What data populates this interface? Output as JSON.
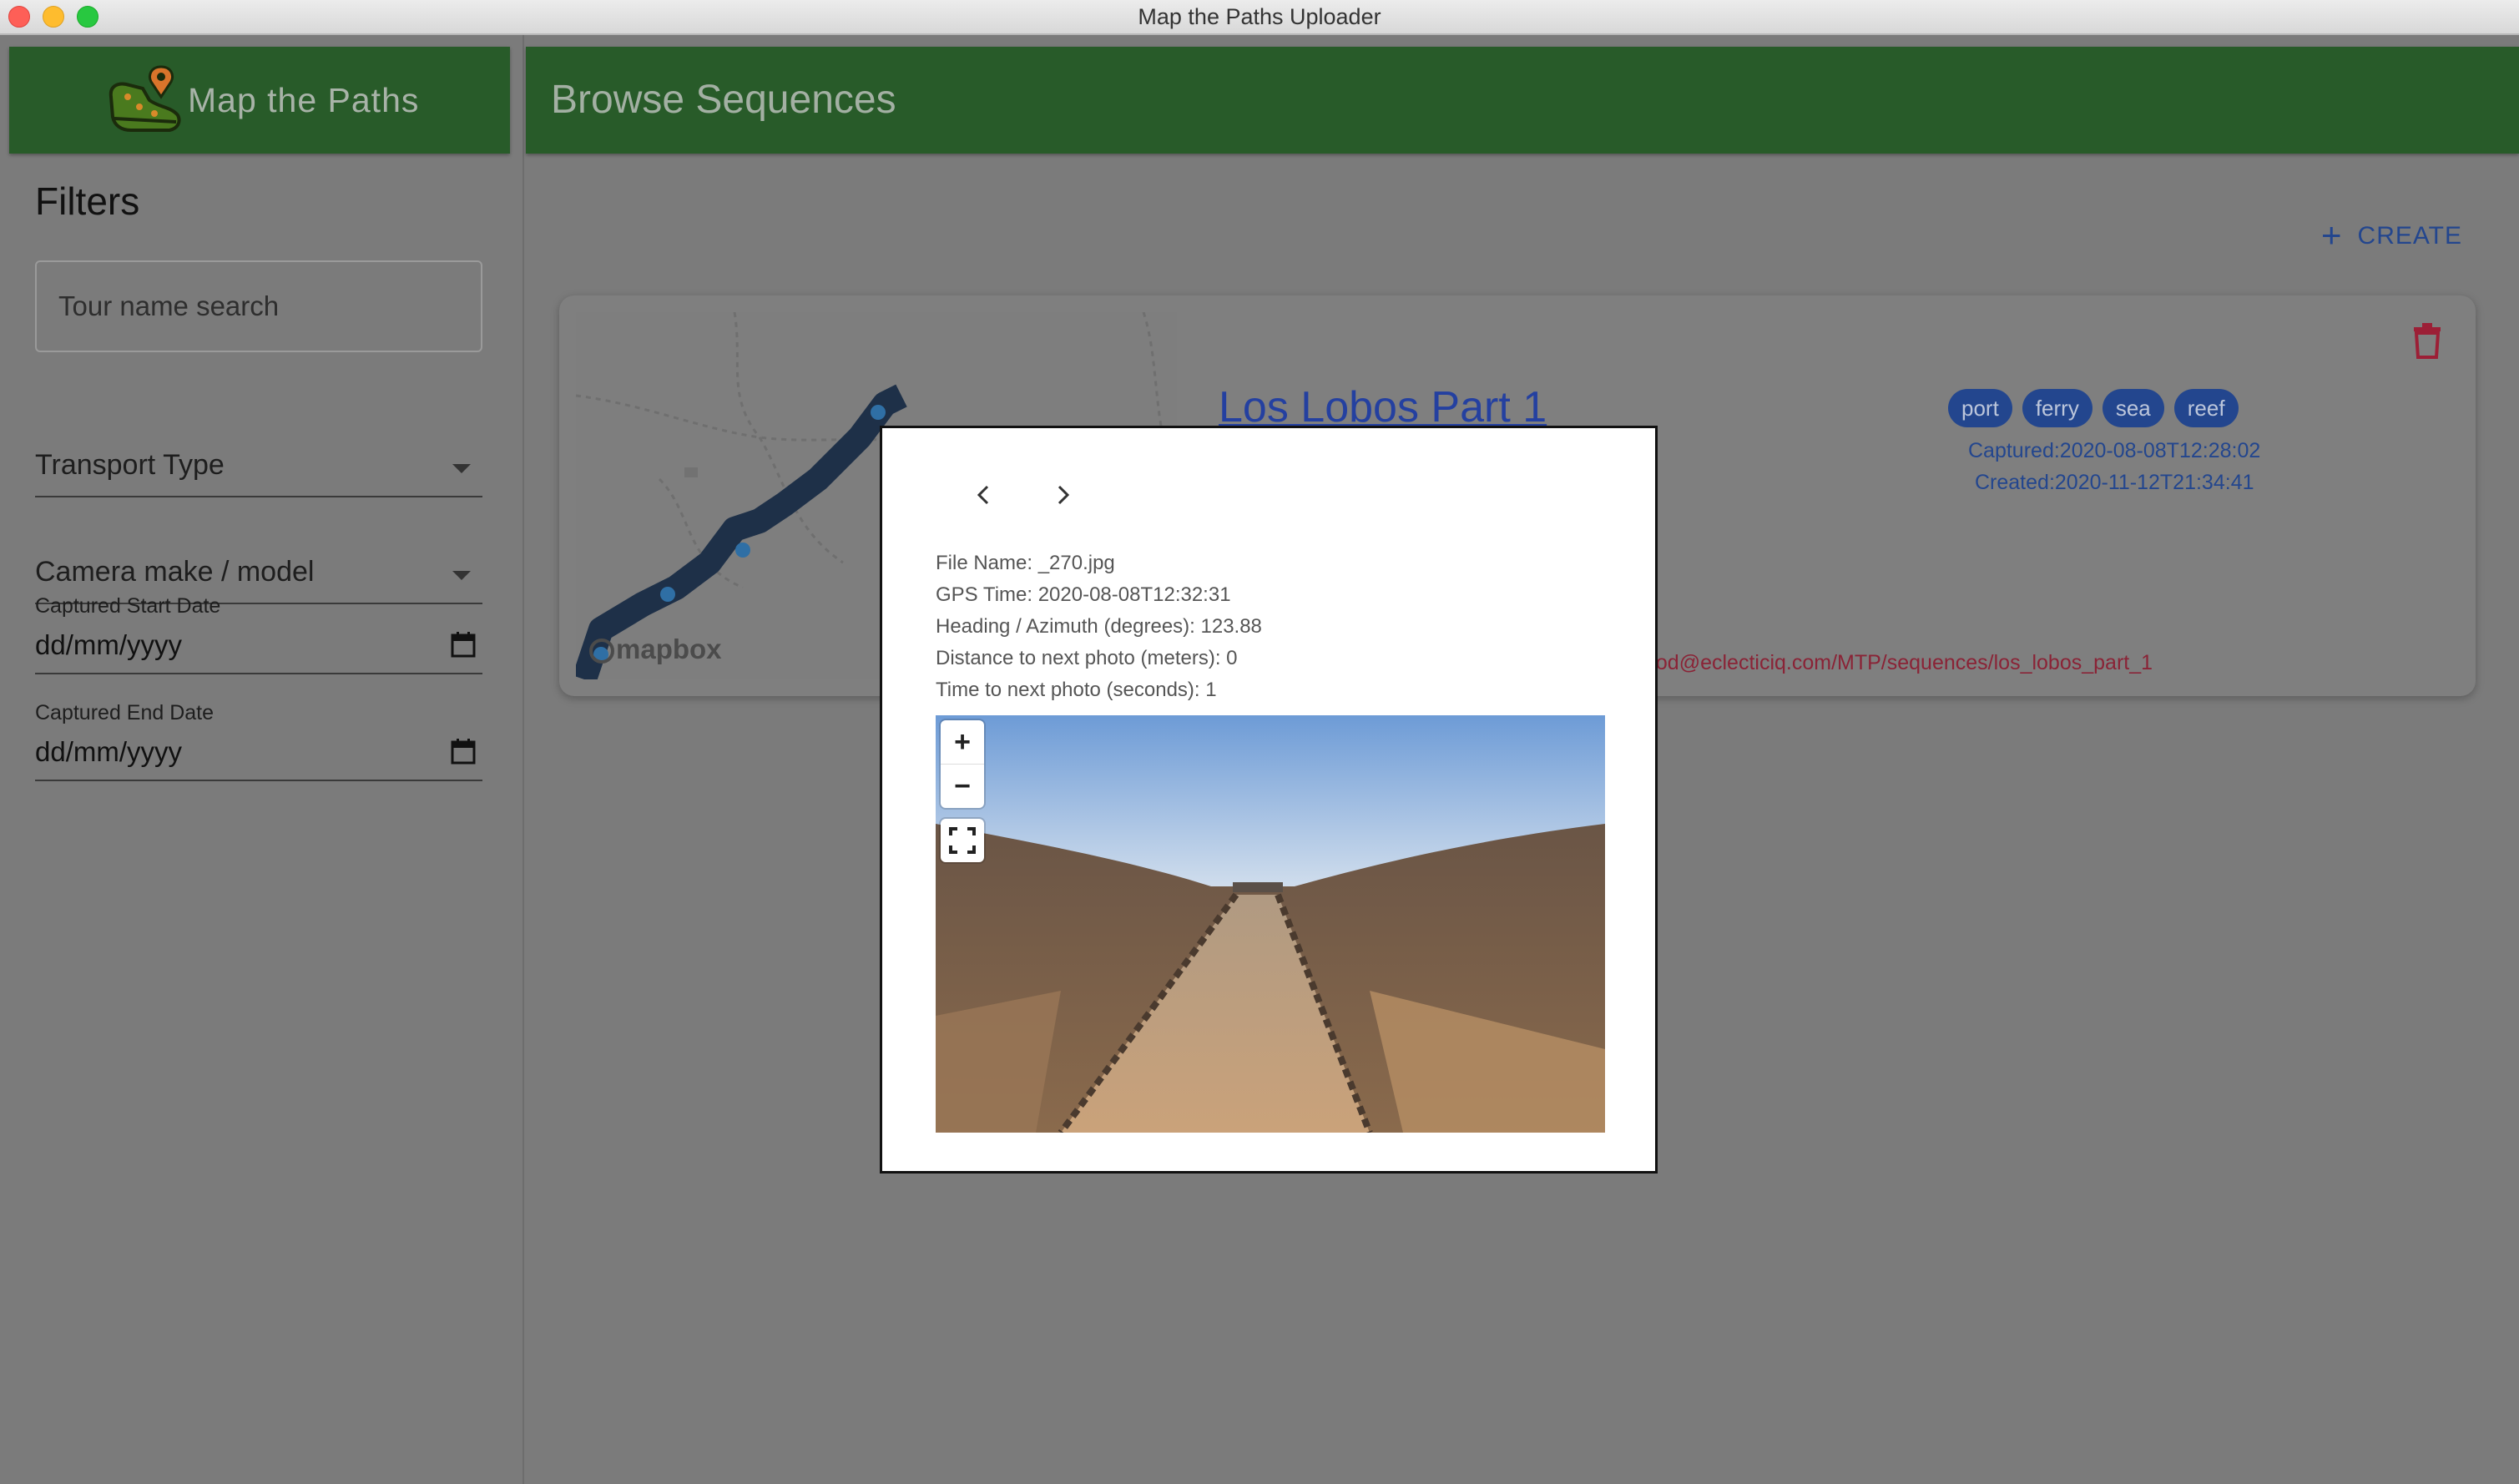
{
  "window": {
    "title": "Map the Paths Uploader"
  },
  "sidebar": {
    "brand": "Map the Paths",
    "filters_title": "Filters",
    "search_placeholder": "Tour name search",
    "transport_label": "Transport Type",
    "camera_label": "Camera make / model",
    "start_date_label": "Captured Start Date",
    "start_date_value": "dd/mm/yyyy",
    "end_date_label": "Captured End Date",
    "end_date_value": "dd/mm/yyyy"
  },
  "main": {
    "title": "Browse Sequences",
    "create_label": "CREATE",
    "card": {
      "title": "Los Lobos Part 1",
      "tags": [
        "port",
        "ferry",
        "sea",
        "reef"
      ],
      "captured": "Captured:2020-08-08T12:28:02",
      "created": "Created:2020-11-12T21:34:41",
      "link": "ood@eclecticiq.com/MTP/sequences/los_lobos_part_1",
      "map_attribution": "mapbox"
    }
  },
  "modal": {
    "file_name": "File Name: _270.jpg",
    "gps_time": "GPS Time: 2020-08-08T12:32:31",
    "heading": "Heading / Azimuth (degrees): 123.88",
    "distance": "Distance to next photo (meters): 0",
    "time_next": "Time to next photo (seconds): 1",
    "zoom_in": "+",
    "zoom_out": "−"
  }
}
